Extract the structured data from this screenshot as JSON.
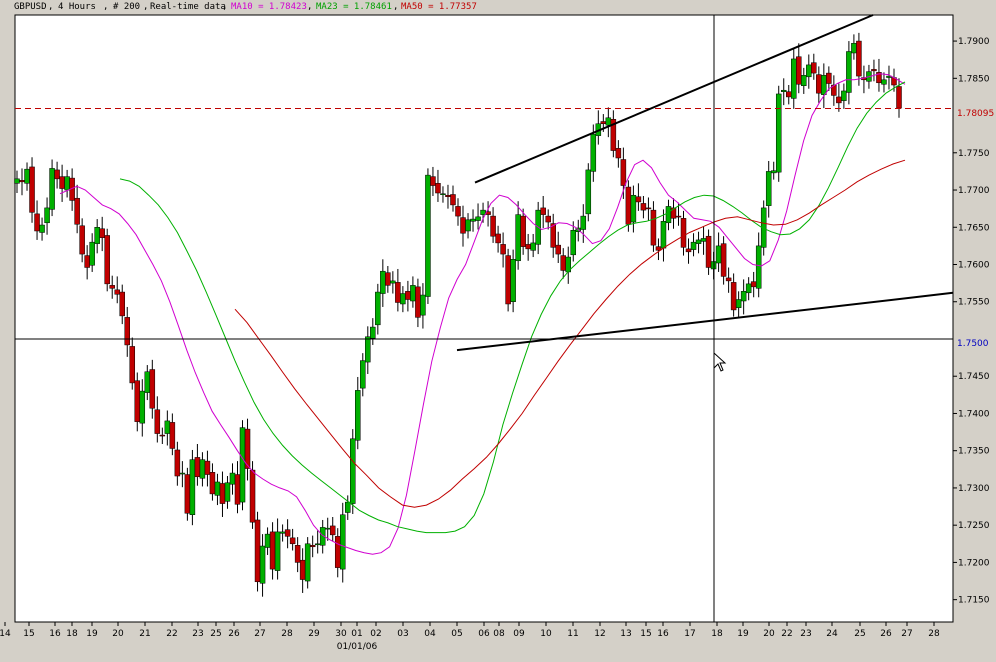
{
  "header": {
    "symbol": "GBPUSD",
    "timeframe": "4 Hours",
    "count": "# 200",
    "mode": "Real-time data",
    "ma10_label": "MA10 = 1.78423",
    "ma23_label": "MA23 = 1.78461",
    "ma50_label": "MA50 = 1.77357"
  },
  "colors": {
    "plot_bg": "#ffffff",
    "frame_bg": "#d4d0c8",
    "bull": "#00b000",
    "bear": "#c00000",
    "ma10": "#d000d0",
    "ma23": "#00b000",
    "ma50": "#c00000",
    "current_price": "#c00000",
    "crosshair_price": "#0000c0",
    "trendline": "#000000"
  },
  "crosshair": {
    "price_label": "1.7500",
    "date_tick": "18"
  },
  "current_price_label": "1.78095",
  "chart_data": {
    "type": "candlestick",
    "title": "",
    "xlabel": "",
    "ylabel": "",
    "ylim": [
      1.712,
      1.7935
    ],
    "y_ticks": [
      "1.7900",
      "1.7850",
      "1.7750",
      "1.7700",
      "1.7650",
      "1.7600",
      "1.7550",
      "1.7450",
      "1.7400",
      "1.7350",
      "1.7300",
      "1.7250",
      "1.7200",
      "1.7150"
    ],
    "x_ticks": [
      "14",
      "15",
      "16",
      "18",
      "19",
      "20",
      "21",
      "22",
      "23",
      "25",
      "26",
      "27",
      "28",
      "29",
      "30",
      "01",
      "02",
      "03",
      "04",
      "05",
      "06",
      "08",
      "09",
      "10",
      "11",
      "12",
      "13",
      "15",
      "16",
      "17",
      "18",
      "19",
      "20",
      "22",
      "23",
      "24",
      "25",
      "26",
      "27",
      "28"
    ],
    "x_month_label": "01/01/06",
    "closes": [
      1.7715,
      1.7711,
      1.7728,
      1.767,
      1.7645,
      1.7653,
      1.7676,
      1.7729,
      1.7715,
      1.7702,
      1.7718,
      1.7686,
      1.7654,
      1.7614,
      1.7596,
      1.763,
      1.765,
      1.7636,
      1.7574,
      1.7568,
      1.756,
      1.7531,
      1.7492,
      1.7441,
      1.7389,
      1.743,
      1.7456,
      1.7407,
      1.7373,
      1.737,
      1.739,
      1.7353,
      1.7316,
      1.732,
      1.7266,
      1.7338,
      1.7315,
      1.7338,
      1.7318,
      1.7292,
      1.7308,
      1.7279,
      1.7307,
      1.732,
      1.7278,
      1.7381,
      1.7326,
      1.7254,
      1.7174,
      1.7222,
      1.7238,
      1.7191,
      1.7241,
      1.7241,
      1.7235,
      1.7225,
      1.72,
      1.7177,
      1.7225,
      1.7221,
      1.7225,
      1.7247,
      1.7246,
      1.7237,
      1.7193,
      1.7264,
      1.7281,
      1.7366,
      1.7431,
      1.7471,
      1.7503,
      1.7516,
      1.7563,
      1.7591,
      1.7572,
      1.7578,
      1.7549,
      1.7561,
      1.7553,
      1.7572,
      1.7529,
      1.7559,
      1.772,
      1.7706,
      1.7696,
      1.7695,
      1.7691,
      1.768,
      1.7665,
      1.7642,
      1.766,
      1.7661,
      1.7664,
      1.7673,
      1.7667,
      1.7638,
      1.7629,
      1.7614,
      1.7547,
      1.7607,
      1.7667,
      1.7624,
      1.7621,
      1.7629,
      1.7673,
      1.7667,
      1.7657,
      1.7623,
      1.7614,
      1.7592,
      1.761,
      1.7646,
      1.7649,
      1.7665,
      1.7727,
      1.7775,
      1.7789,
      1.7789,
      1.7797,
      1.7753,
      1.7743,
      1.7706,
      1.7654,
      1.7693,
      1.7684,
      1.7673,
      1.7675,
      1.7626,
      1.7619,
      1.7658,
      1.7678,
      1.7662,
      1.7664,
      1.7623,
      1.7617,
      1.763,
      1.7633,
      1.7635,
      1.7596,
      1.7604,
      1.7625,
      1.7584,
      1.7578,
      1.7539,
      1.7553,
      1.7564,
      1.7574,
      1.757,
      1.7625,
      1.7676,
      1.7725,
      1.7726,
      1.7829,
      1.7834,
      1.7825,
      1.7876,
      1.7842,
      1.7854,
      1.7868,
      1.7857,
      1.783,
      1.7854,
      1.7843,
      1.7827,
      1.7817,
      1.7833,
      1.7886,
      1.7897,
      1.7853,
      1.7848,
      1.7859,
      1.786,
      1.7844,
      1.7848,
      1.7853,
      1.7841,
      1.781
    ],
    "series": [
      {
        "name": "MA10",
        "values": [
          1.7695,
          1.77,
          1.7705,
          1.77,
          1.769,
          1.768,
          1.7675,
          1.7668,
          1.7655,
          1.764,
          1.762,
          1.76,
          1.7578,
          1.755,
          1.7518,
          1.7485,
          1.7455,
          1.7428,
          1.7403,
          1.7385,
          1.7368,
          1.735,
          1.7333,
          1.732,
          1.7312,
          1.7305,
          1.73,
          1.7296,
          1.7288,
          1.727,
          1.725,
          1.7237,
          1.723,
          1.7224,
          1.722,
          1.7216,
          1.7213,
          1.7211,
          1.7213,
          1.7221,
          1.7246,
          1.729,
          1.735,
          1.7412,
          1.747,
          1.7515,
          1.7555,
          1.758,
          1.76,
          1.763,
          1.766,
          1.7682,
          1.7693,
          1.769,
          1.768,
          1.7667,
          1.7655,
          1.7647,
          1.765,
          1.7656,
          1.7655,
          1.765,
          1.764,
          1.7628,
          1.7632,
          1.7648,
          1.7677,
          1.771,
          1.7734,
          1.774,
          1.773,
          1.771,
          1.7693,
          1.7684,
          1.7673,
          1.7662,
          1.766,
          1.7658,
          1.765,
          1.7636,
          1.7622,
          1.7608,
          1.76,
          1.7598,
          1.7605,
          1.7633,
          1.7672,
          1.772,
          1.7766,
          1.78,
          1.782,
          1.7836,
          1.7843,
          1.7848,
          1.7848,
          1.785,
          1.7853,
          1.7856,
          1.7855,
          1.7849,
          1.7842
        ]
      },
      {
        "name": "MA23",
        "values": [
          1.7715,
          1.7712,
          1.7705,
          1.7693,
          1.768,
          1.7663,
          1.7643,
          1.7618,
          1.7592,
          1.7563,
          1.7533,
          1.7502,
          1.7471,
          1.7442,
          1.7415,
          1.7392,
          1.7373,
          1.7357,
          1.7343,
          1.7331,
          1.732,
          1.731,
          1.73,
          1.729,
          1.728,
          1.727,
          1.7263,
          1.7257,
          1.7253,
          1.7248,
          1.7245,
          1.7242,
          1.724,
          1.724,
          1.724,
          1.7242,
          1.7248,
          1.7263,
          1.7292,
          1.7335,
          1.7385,
          1.7427,
          1.7466,
          1.7503,
          1.7533,
          1.7558,
          1.7578,
          1.7593,
          1.7605,
          1.7616,
          1.7627,
          1.7637,
          1.7646,
          1.7653,
          1.7656,
          1.7658,
          1.7662,
          1.7668,
          1.7676,
          1.7684,
          1.769,
          1.7693,
          1.7692,
          1.7686,
          1.7678,
          1.7669,
          1.7659,
          1.765,
          1.7644,
          1.764,
          1.7641,
          1.7648,
          1.766,
          1.7679,
          1.7703,
          1.773,
          1.7758,
          1.7783,
          1.7803,
          1.7818,
          1.783,
          1.7838,
          1.7845
        ]
      },
      {
        "name": "MA50",
        "values": [
          1.754,
          1.7522,
          1.75,
          1.7478,
          1.7455,
          1.7433,
          1.7412,
          1.7392,
          1.7372,
          1.7352,
          1.7333,
          1.7317,
          1.73,
          1.7288,
          1.7277,
          1.7274,
          1.7277,
          1.7285,
          1.7297,
          1.7312,
          1.7326,
          1.7341,
          1.7359,
          1.7379,
          1.74,
          1.7424,
          1.7447,
          1.747,
          1.7492,
          1.7513,
          1.7534,
          1.7553,
          1.7571,
          1.7587,
          1.7601,
          1.7613,
          1.7624,
          1.7634,
          1.7643,
          1.765,
          1.7657,
          1.7662,
          1.7664,
          1.766,
          1.7656,
          1.7653,
          1.7654,
          1.766,
          1.7669,
          1.768,
          1.769,
          1.77,
          1.7711,
          1.772,
          1.7728,
          1.7735,
          1.774
        ]
      }
    ],
    "trendlines": [
      {
        "name": "upper-channel",
        "from": [
          1.771
        ],
        "to": [
          1.7935
        ]
      },
      {
        "name": "lower-channel",
        "from": [
          1.7485
        ],
        "to": [
          1.7562
        ]
      }
    ]
  }
}
